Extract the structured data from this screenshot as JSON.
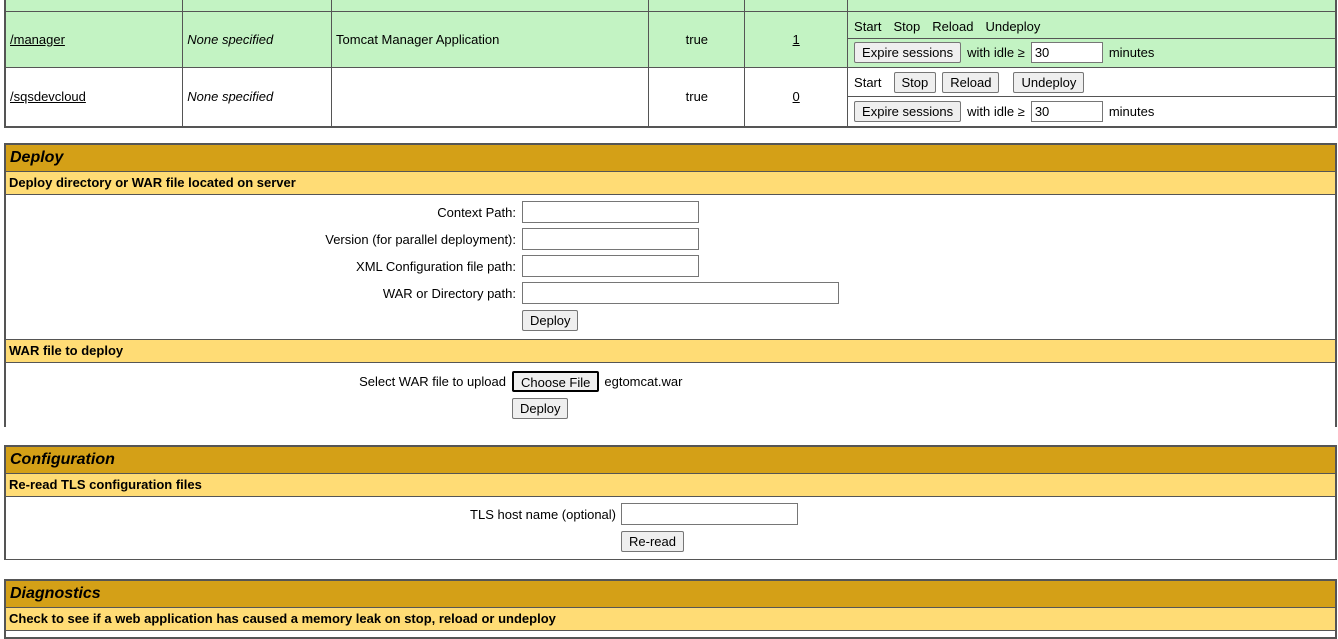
{
  "apps": {
    "rows": [
      {
        "path": "/manager",
        "version": "None specified",
        "display_name": "Tomcat Manager Application",
        "running": "true",
        "sessions": "1",
        "commands": [
          "Start",
          "Stop",
          "Reload",
          "Undeploy"
        ],
        "expire_label": "Expire sessions",
        "with_idle": "with idle ≥",
        "idle_value": "30",
        "minutes": "minutes"
      },
      {
        "path": "/sqsdevcloud",
        "version": "None specified",
        "display_name": "",
        "running": "true",
        "sessions": "0",
        "start_label": "Start",
        "stop_label": "Stop",
        "reload_label": "Reload",
        "undeploy_label": "Undeploy",
        "expire_label": "Expire sessions",
        "with_idle": "with idle ≥",
        "idle_value": "30",
        "minutes": "minutes"
      }
    ]
  },
  "deploy": {
    "title": "Deploy",
    "server_subtitle": "Deploy directory or WAR file located on server",
    "context_path_label": "Context Path:",
    "version_label": "Version (for parallel deployment):",
    "xml_config_label": "XML Configuration file path:",
    "war_dir_label": "WAR or Directory path:",
    "deploy_button": "Deploy",
    "war_subtitle": "WAR file to deploy",
    "select_war_label": "Select WAR file to upload",
    "choose_file_button": "Choose File",
    "chosen_file": "egtomcat.war",
    "upload_deploy_button": "Deploy"
  },
  "configuration": {
    "title": "Configuration",
    "subtitle": "Re-read TLS configuration files",
    "tls_label": "TLS host name (optional)",
    "reread_button": "Re-read"
  },
  "diagnostics": {
    "title": "Diagnostics",
    "subtitle": "Check to see if a web application has caused a memory leak on stop, reload or undeploy"
  }
}
